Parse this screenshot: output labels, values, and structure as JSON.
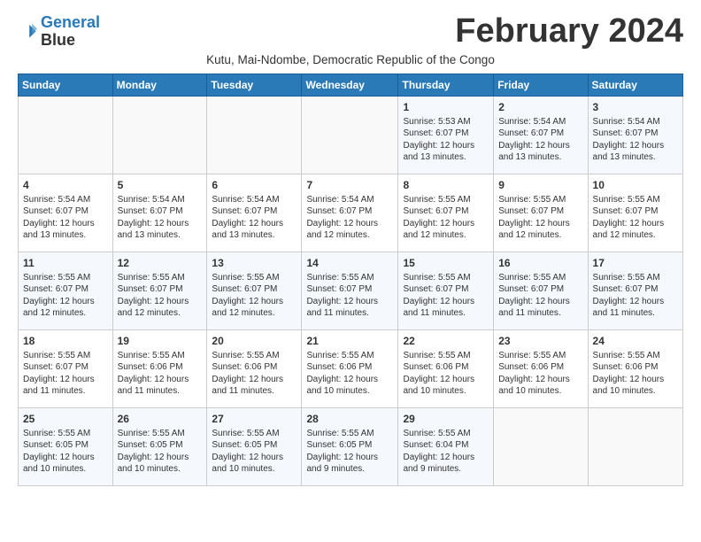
{
  "header": {
    "logo_line1": "General",
    "logo_line2": "Blue",
    "month_title": "February 2024",
    "subtitle": "Kutu, Mai-Ndombe, Democratic Republic of the Congo"
  },
  "days_of_week": [
    "Sunday",
    "Monday",
    "Tuesday",
    "Wednesday",
    "Thursday",
    "Friday",
    "Saturday"
  ],
  "weeks": [
    [
      {
        "day": "",
        "info": ""
      },
      {
        "day": "",
        "info": ""
      },
      {
        "day": "",
        "info": ""
      },
      {
        "day": "",
        "info": ""
      },
      {
        "day": "1",
        "info": "Sunrise: 5:53 AM\nSunset: 6:07 PM\nDaylight: 12 hours\nand 13 minutes."
      },
      {
        "day": "2",
        "info": "Sunrise: 5:54 AM\nSunset: 6:07 PM\nDaylight: 12 hours\nand 13 minutes."
      },
      {
        "day": "3",
        "info": "Sunrise: 5:54 AM\nSunset: 6:07 PM\nDaylight: 12 hours\nand 13 minutes."
      }
    ],
    [
      {
        "day": "4",
        "info": "Sunrise: 5:54 AM\nSunset: 6:07 PM\nDaylight: 12 hours\nand 13 minutes."
      },
      {
        "day": "5",
        "info": "Sunrise: 5:54 AM\nSunset: 6:07 PM\nDaylight: 12 hours\nand 13 minutes."
      },
      {
        "day": "6",
        "info": "Sunrise: 5:54 AM\nSunset: 6:07 PM\nDaylight: 12 hours\nand 13 minutes."
      },
      {
        "day": "7",
        "info": "Sunrise: 5:54 AM\nSunset: 6:07 PM\nDaylight: 12 hours\nand 12 minutes."
      },
      {
        "day": "8",
        "info": "Sunrise: 5:55 AM\nSunset: 6:07 PM\nDaylight: 12 hours\nand 12 minutes."
      },
      {
        "day": "9",
        "info": "Sunrise: 5:55 AM\nSunset: 6:07 PM\nDaylight: 12 hours\nand 12 minutes."
      },
      {
        "day": "10",
        "info": "Sunrise: 5:55 AM\nSunset: 6:07 PM\nDaylight: 12 hours\nand 12 minutes."
      }
    ],
    [
      {
        "day": "11",
        "info": "Sunrise: 5:55 AM\nSunset: 6:07 PM\nDaylight: 12 hours\nand 12 minutes."
      },
      {
        "day": "12",
        "info": "Sunrise: 5:55 AM\nSunset: 6:07 PM\nDaylight: 12 hours\nand 12 minutes."
      },
      {
        "day": "13",
        "info": "Sunrise: 5:55 AM\nSunset: 6:07 PM\nDaylight: 12 hours\nand 12 minutes."
      },
      {
        "day": "14",
        "info": "Sunrise: 5:55 AM\nSunset: 6:07 PM\nDaylight: 12 hours\nand 11 minutes."
      },
      {
        "day": "15",
        "info": "Sunrise: 5:55 AM\nSunset: 6:07 PM\nDaylight: 12 hours\nand 11 minutes."
      },
      {
        "day": "16",
        "info": "Sunrise: 5:55 AM\nSunset: 6:07 PM\nDaylight: 12 hours\nand 11 minutes."
      },
      {
        "day": "17",
        "info": "Sunrise: 5:55 AM\nSunset: 6:07 PM\nDaylight: 12 hours\nand 11 minutes."
      }
    ],
    [
      {
        "day": "18",
        "info": "Sunrise: 5:55 AM\nSunset: 6:07 PM\nDaylight: 12 hours\nand 11 minutes."
      },
      {
        "day": "19",
        "info": "Sunrise: 5:55 AM\nSunset: 6:06 PM\nDaylight: 12 hours\nand 11 minutes."
      },
      {
        "day": "20",
        "info": "Sunrise: 5:55 AM\nSunset: 6:06 PM\nDaylight: 12 hours\nand 11 minutes."
      },
      {
        "day": "21",
        "info": "Sunrise: 5:55 AM\nSunset: 6:06 PM\nDaylight: 12 hours\nand 10 minutes."
      },
      {
        "day": "22",
        "info": "Sunrise: 5:55 AM\nSunset: 6:06 PM\nDaylight: 12 hours\nand 10 minutes."
      },
      {
        "day": "23",
        "info": "Sunrise: 5:55 AM\nSunset: 6:06 PM\nDaylight: 12 hours\nand 10 minutes."
      },
      {
        "day": "24",
        "info": "Sunrise: 5:55 AM\nSunset: 6:06 PM\nDaylight: 12 hours\nand 10 minutes."
      }
    ],
    [
      {
        "day": "25",
        "info": "Sunrise: 5:55 AM\nSunset: 6:05 PM\nDaylight: 12 hours\nand 10 minutes."
      },
      {
        "day": "26",
        "info": "Sunrise: 5:55 AM\nSunset: 6:05 PM\nDaylight: 12 hours\nand 10 minutes."
      },
      {
        "day": "27",
        "info": "Sunrise: 5:55 AM\nSunset: 6:05 PM\nDaylight: 12 hours\nand 10 minutes."
      },
      {
        "day": "28",
        "info": "Sunrise: 5:55 AM\nSunset: 6:05 PM\nDaylight: 12 hours\nand 9 minutes."
      },
      {
        "day": "29",
        "info": "Sunrise: 5:55 AM\nSunset: 6:04 PM\nDaylight: 12 hours\nand 9 minutes."
      },
      {
        "day": "",
        "info": ""
      },
      {
        "day": "",
        "info": ""
      }
    ]
  ]
}
